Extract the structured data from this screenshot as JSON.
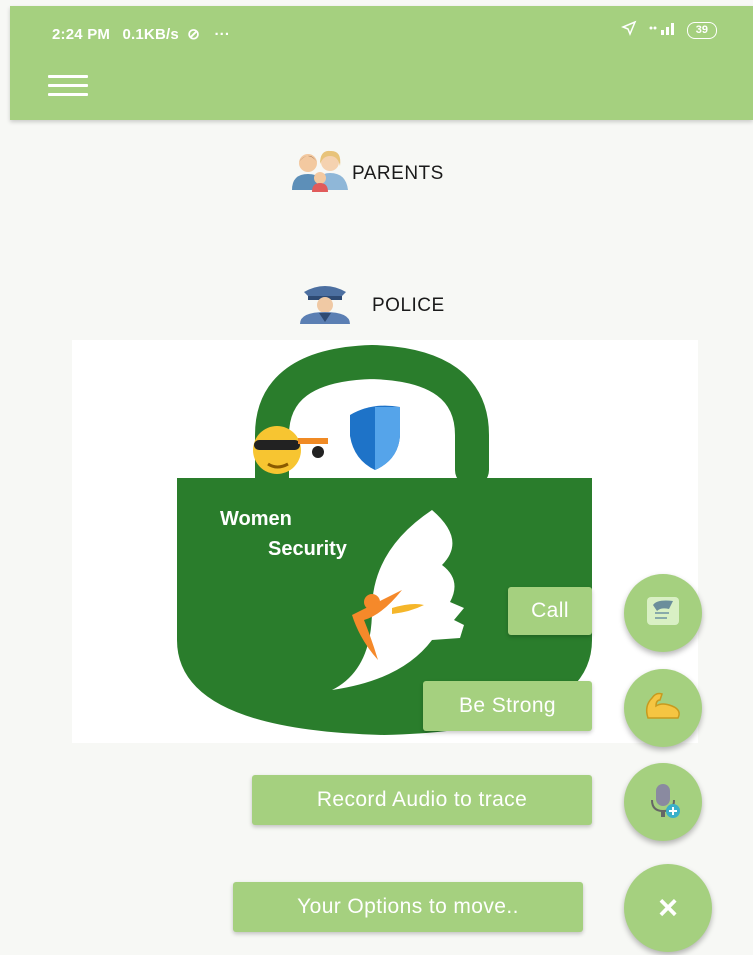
{
  "status_bar": {
    "time": "2:24 PM",
    "speed": "0.1KB/s",
    "extra": "···",
    "battery": "39"
  },
  "menu": {
    "icon": "hamburger-icon"
  },
  "nav": {
    "parents_label": "PARENTS",
    "police_label": "POLICE"
  },
  "banner": {
    "line1": "Women",
    "line2": "Security"
  },
  "actions": {
    "call_label": "Call",
    "strong_label": "Be Strong",
    "record_label": "Record Audio to trace",
    "options_label": "Your Options to move..",
    "close_symbol": "×"
  },
  "colors": {
    "accent": "#a5d07f",
    "lock_green": "#2a7d2c",
    "background": "#f7f8f5"
  }
}
